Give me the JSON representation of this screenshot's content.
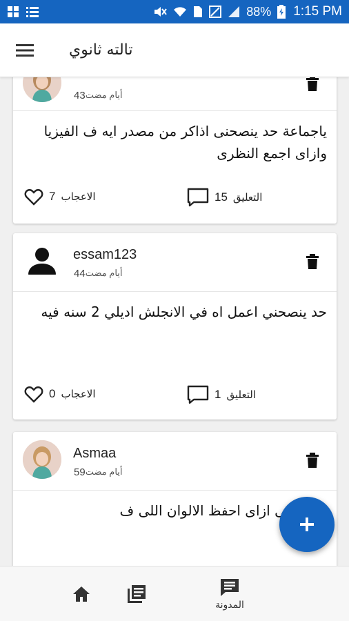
{
  "status_bar": {
    "battery_percent": "88%",
    "time": "1:15 PM"
  },
  "app_bar": {
    "title": "تالته ثانوي"
  },
  "posts": [
    {
      "username": "",
      "time_value": "43",
      "time_unit": "أيام مضت",
      "avatar": "user-photo",
      "text": "ياجماعة حد ينصحنى اذاكر من مصدر ايه ف الفيزيا وازاى اجمع النظرى",
      "likes_label": "الاعجاب",
      "likes_count": "7",
      "comments_label": "التعليق",
      "comments_count": "15"
    },
    {
      "username": "essam123",
      "time_value": "44",
      "time_unit": "أيام مضت",
      "avatar": "person-icon",
      "text": "حد ينصحني اعمل اه في الانجلش اديلي 2 سنه فيه",
      "likes_label": "الاعجاب",
      "likes_count": "0",
      "comments_label": "التعليق",
      "comments_count": "1"
    },
    {
      "username": "Asmaa",
      "time_value": "59",
      "time_unit": "أيام مضت",
      "avatar": "user-photo",
      "text": "ة قولولى ازاى احفظ الالوان اللى ف"
    }
  ],
  "fab": {
    "icon": "plus-icon"
  },
  "bottom_nav": {
    "items": [
      {
        "icon": "home-icon"
      },
      {
        "icon": "library-books-icon"
      },
      {
        "icon": "blog-icon",
        "label": "المدونة"
      }
    ]
  },
  "colors": {
    "primary": "#1565c0",
    "background": "#f0f0f0"
  }
}
